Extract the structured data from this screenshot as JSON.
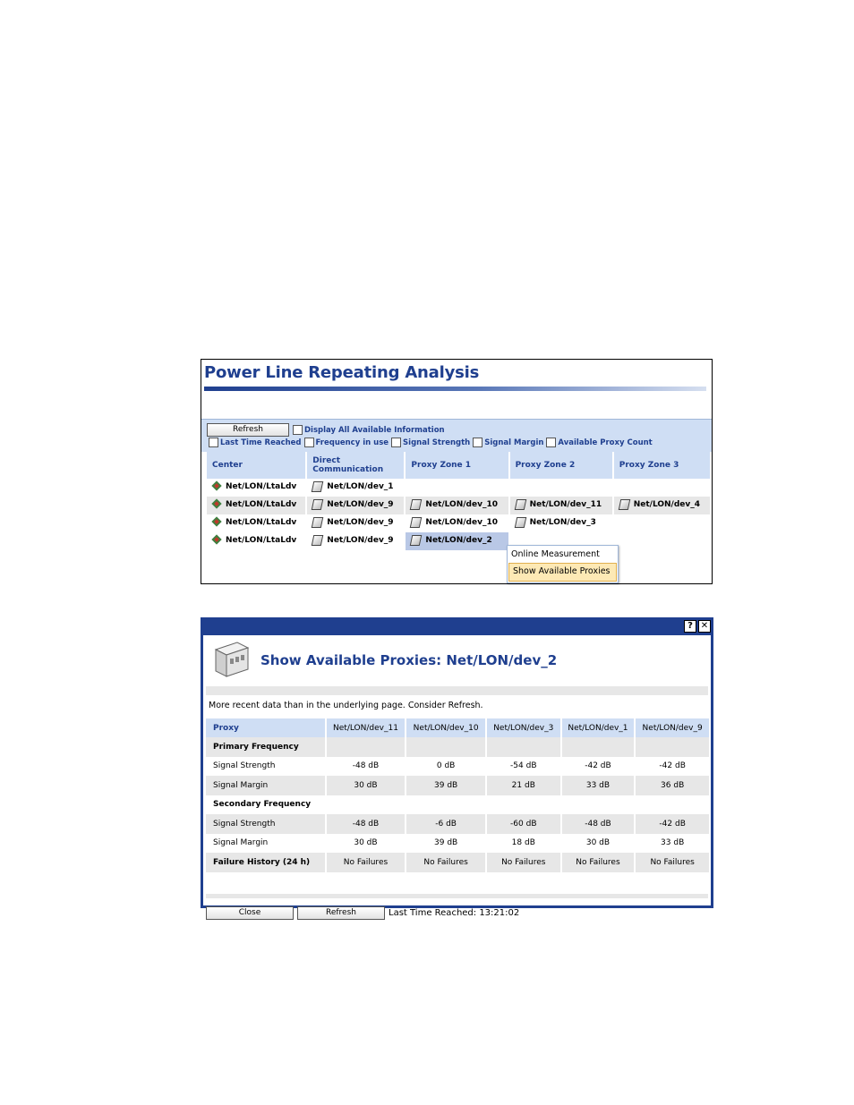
{
  "analysis": {
    "title": "Power Line Repeating Analysis",
    "refresh_label": "Refresh",
    "display_all_label": "Display All Available Information",
    "options": [
      "Last Time Reached",
      "Frequency in use",
      "Signal Strength",
      "Signal Margin",
      "Available Proxy Count"
    ],
    "columns": [
      "Center",
      "Direct\nCommunication",
      "Proxy Zone 1",
      "Proxy Zone 2",
      "Proxy Zone 3"
    ],
    "rows": [
      [
        "Net/LON/LtaLdv",
        "Net/LON/dev_1",
        "",
        "",
        ""
      ],
      [
        "Net/LON/LtaLdv",
        "Net/LON/dev_9",
        "Net/LON/dev_10",
        "Net/LON/dev_11",
        "Net/LON/dev_4"
      ],
      [
        "Net/LON/LtaLdv",
        "Net/LON/dev_9",
        "Net/LON/dev_10",
        "Net/LON/dev_3",
        ""
      ],
      [
        "Net/LON/LtaLdv",
        "Net/LON/dev_9",
        "Net/LON/dev_2",
        "",
        ""
      ]
    ],
    "context_menu": [
      "Online Measurement",
      "Show Available Proxies"
    ]
  },
  "dialog": {
    "title": "Show Available Proxies: Net/LON/dev_2",
    "help_glyph": "?",
    "close_glyph": "✕",
    "note": "More recent data than in the underlying page. Consider Refresh.",
    "header_label": "Proxy",
    "proxies": [
      "Net/LON/dev_11",
      "Net/LON/dev_10",
      "Net/LON/dev_3",
      "Net/LON/dev_1",
      "Net/LON/dev_9"
    ],
    "primary_label": "Primary Frequency",
    "secondary_label": "Secondary Frequency",
    "signal_strength_label": "Signal Strength",
    "signal_margin_label": "Signal Margin",
    "failure_label": "Failure History (24 h)",
    "primary_strength": [
      "-48 dB",
      "0 dB",
      "-54 dB",
      "-42 dB",
      "-42 dB"
    ],
    "primary_margin": [
      "30 dB",
      "39 dB",
      "21 dB",
      "33 dB",
      "36 dB"
    ],
    "secondary_strength": [
      "-48 dB",
      "-6 dB",
      "-60 dB",
      "-48 dB",
      "-42 dB"
    ],
    "secondary_margin": [
      "30 dB",
      "39 dB",
      "18 dB",
      "30 dB",
      "33 dB"
    ],
    "failures": [
      "No Failures",
      "No Failures",
      "No Failures",
      "No Failures",
      "No Failures"
    ],
    "close_label": "Close",
    "refresh_label": "Refresh",
    "last_time": "Last Time Reached: 13:21:02"
  }
}
